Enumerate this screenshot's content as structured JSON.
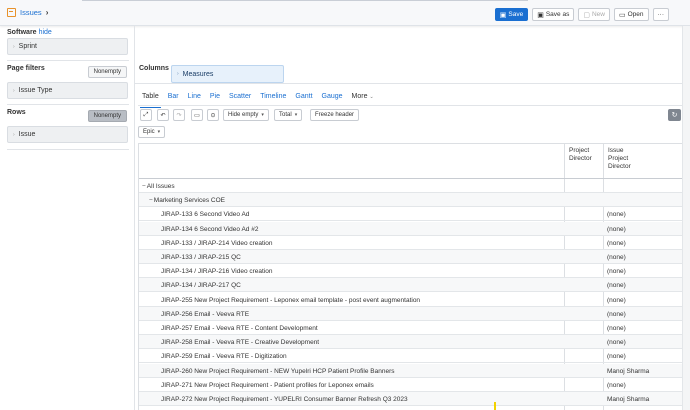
{
  "header": {
    "breadcrumb": "Issues",
    "buttons": {
      "save": "Save",
      "save_as": "Save as",
      "new": "New",
      "open": "Open",
      "more": "···"
    }
  },
  "left": {
    "software": {
      "title": "Software",
      "hide_label": "hide",
      "chip": "Sprint"
    },
    "page_filters": {
      "title": "Page filters",
      "nonempty": "Nonempty",
      "chip": "Issue Type"
    },
    "rows": {
      "title": "Rows",
      "nonempty": "Nonempty",
      "chip": "Issue"
    }
  },
  "columns": {
    "title": "Columns",
    "chip": "Measures"
  },
  "tabs": [
    "Table",
    "Bar",
    "Line",
    "Pie",
    "Scatter",
    "Timeline",
    "Gantt",
    "Gauge",
    "More"
  ],
  "toolbar": {
    "hide_empty": "Hide empty",
    "total": "Total",
    "freeze_header": "Freeze header"
  },
  "epic_filter": "Epic",
  "table": {
    "headers": {
      "project_director": [
        "Project",
        "Director"
      ],
      "issue_project_director": [
        "Issue",
        "Project",
        "Director"
      ]
    },
    "rows": [
      {
        "name": "All Issues",
        "level": 0,
        "toggle": "−",
        "value": ""
      },
      {
        "name": "Marketing Services COE",
        "level": 1,
        "toggle": "−",
        "value": ""
      },
      {
        "name": "JIRAP-133 6 Second Video Ad",
        "level": 2,
        "toggle": "",
        "value": "(none)"
      },
      {
        "name": "JIRAP-134 6 Second Video Ad #2",
        "level": 2,
        "toggle": "",
        "value": "(none)"
      },
      {
        "name": "JIRAP-133 / JIRAP-214 Video creation",
        "level": 2,
        "toggle": "",
        "value": "(none)"
      },
      {
        "name": "JIRAP-133 / JIRAP-215 QC",
        "level": 2,
        "toggle": "",
        "value": "(none)"
      },
      {
        "name": "JIRAP-134 / JIRAP-216 Video creation",
        "level": 2,
        "toggle": "",
        "value": "(none)"
      },
      {
        "name": "JIRAP-134 / JIRAP-217 QC",
        "level": 2,
        "toggle": "",
        "value": "(none)"
      },
      {
        "name": "JIRAP-255 New Project Requirement - Leponex email template - post event augmentation",
        "level": 2,
        "toggle": "",
        "value": "(none)"
      },
      {
        "name": "JIRAP-256 Email - Veeva RTE",
        "level": 2,
        "toggle": "",
        "value": "(none)"
      },
      {
        "name": "JIRAP-257 Email - Veeva RTE - Content Development",
        "level": 2,
        "toggle": "",
        "value": "(none)"
      },
      {
        "name": "JIRAP-258 Email - Veeva RTE - Creative Development",
        "level": 2,
        "toggle": "",
        "value": "(none)"
      },
      {
        "name": "JIRAP-259 Email - Veeva RTE - Digitization",
        "level": 2,
        "toggle": "",
        "value": "(none)"
      },
      {
        "name": "JIRAP-260 New Project Requirement - NEW Yupelri HCP Patient Profile Banners",
        "level": 2,
        "toggle": "",
        "value": "Manoj Sharma"
      },
      {
        "name": "JIRAP-271 New Project Requirement - Patient profiles for Leponex emails",
        "level": 2,
        "toggle": "",
        "value": "(none)"
      },
      {
        "name": "JIRAP-272 New Project Requirement - YUPELRI Consumer Banner Refresh Q3 2023",
        "level": 2,
        "toggle": "",
        "value": "Manoj Sharma"
      }
    ]
  }
}
